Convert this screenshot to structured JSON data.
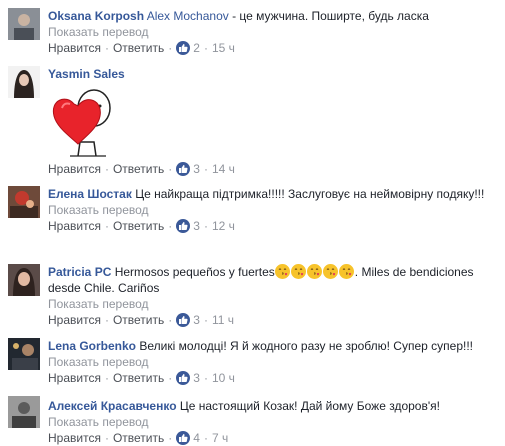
{
  "ui": {
    "like_label": "Нравится",
    "reply_label": "Ответить",
    "see_translation": "Показать перевод",
    "separator": "·"
  },
  "colors": {
    "link": "#365899",
    "meta": "#90949c",
    "like_badge": "#3b5998"
  },
  "comments": [
    {
      "author": "Oksana Korposh",
      "mention": "Alex Mochanov",
      "text": " - це мужчина. Поширте, будь ласка",
      "likes": "2",
      "time": "15 ч",
      "avatar_icon": "profile-photo-icon"
    },
    {
      "author": "Yasmin Sales",
      "sticker": "heart-sticker-icon",
      "likes": "3",
      "time": "14 ч",
      "avatar_icon": "profile-photo-icon"
    },
    {
      "author": "Елена Шостак",
      "text": " Це найкраща підтримка!!!!! Заслуговує на неймовірну подяку!!!",
      "likes": "3",
      "time": "12 ч",
      "avatar_icon": "profile-photo-icon"
    },
    {
      "author": "Patricia PC",
      "text_a": " Hermosos pequeños y fuertes",
      "emoji": "kissing-face-icon",
      "emoji_count": 5,
      "text_b": ". Miles de bendiciones desde Chile. Cariños",
      "likes": "3",
      "time": "11 ч",
      "avatar_icon": "profile-photo-icon"
    },
    {
      "author": "Lena Gorbenko",
      "text": " Великі молодці! Я й жодного разу не зроблю! Супер супер!!!",
      "likes": "3",
      "time": "10 ч",
      "avatar_icon": "profile-photo-icon"
    },
    {
      "author": "Алексей Красавченко",
      "text": " Це настоящий Козак! Дай йому Боже здоров'я!",
      "likes": "4",
      "time": "7 ч",
      "avatar_icon": "profile-photo-icon"
    }
  ]
}
